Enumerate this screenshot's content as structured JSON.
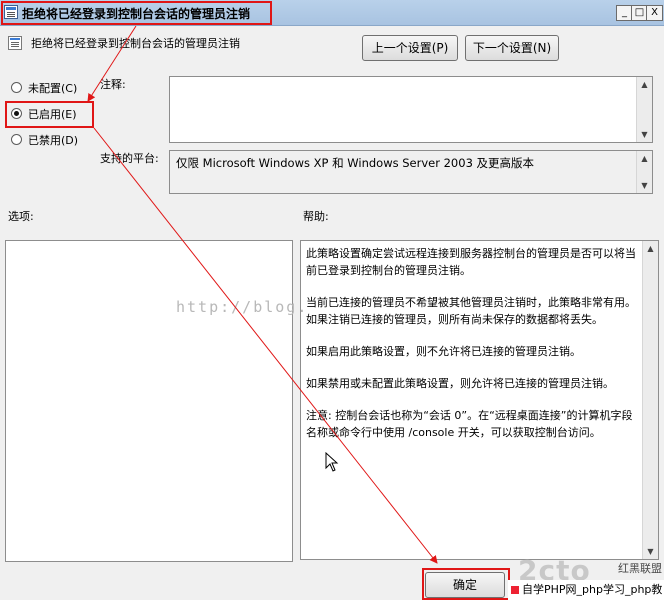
{
  "window": {
    "title": "拒绝将已经登录到控制台会话的管理员注销",
    "min_glyph": "_",
    "max_glyph": "□",
    "close_glyph": "X"
  },
  "header": {
    "policy_name": "拒绝将已经登录到控制台会话的管理员注销",
    "prev_button": "上一个设置(P)",
    "next_button": "下一个设置(N)"
  },
  "state": {
    "options": [
      {
        "label": "未配置(C)",
        "checked": false
      },
      {
        "label": "已启用(E)",
        "checked": true
      },
      {
        "label": "已禁用(D)",
        "checked": false
      }
    ]
  },
  "labels": {
    "comment": "注释:",
    "platform": "支持的平台:",
    "options": "选项:",
    "help": "帮助:"
  },
  "platform_text": "仅限 Microsoft Windows XP 和 Windows Server 2003 及更高版本",
  "help_paragraphs": [
    "此策略设置确定尝试远程连接到服务器控制台的管理员是否可以将当前已登录到控制台的管理员注销。",
    "当前已连接的管理员不希望被其他管理员注销时，此策略非常有用。如果注销已连接的管理员，则所有尚未保存的数据都将丢失。",
    "如果启用此策略设置，则不允许将已连接的管理员注销。",
    "如果禁用或未配置此策略设置，则允许将已连接的管理员注销。",
    "注意: 控制台会话也称为“会话 0”。在“远程桌面连接”的计算机字段名称或命令行中使用 /console 开关，可以获取控制台访问。"
  ],
  "footer": {
    "ok_button": "确定",
    "banner_text": "自学PHP网_php学习_php教"
  },
  "watermark": {
    "url_text": "http://blog.",
    "logo_text": "2cto",
    "logo_tag": "红黑联盟"
  },
  "colors": {
    "annotation_red": "#e01616",
    "titlebar": "#b9d1ea",
    "dialog_bg": "#f0f0f0"
  },
  "icons": {
    "title": "policy-icon",
    "scroll_up": "triangle-up",
    "scroll_down": "triangle-down"
  }
}
